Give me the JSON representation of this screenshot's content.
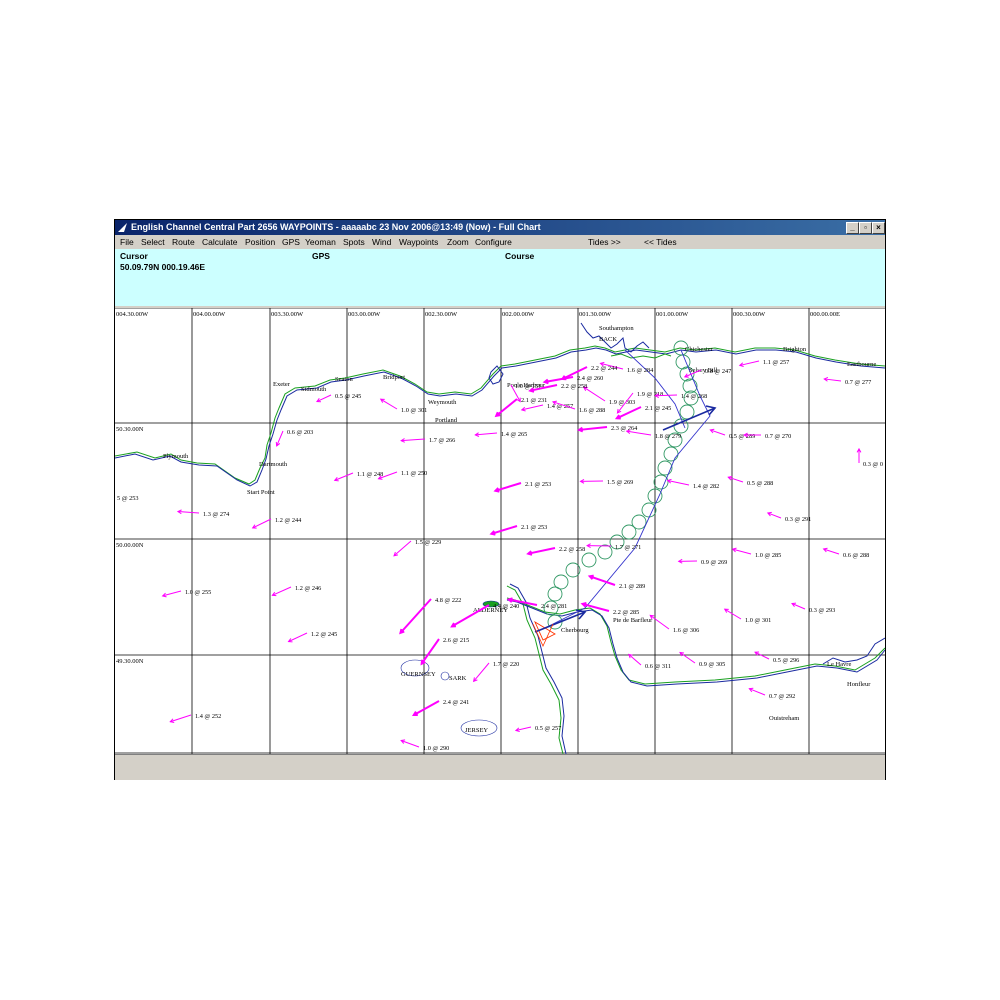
{
  "window": {
    "title": "English Channel Central Part 2656   WAYPOINTS - aaaaabc    23 Nov 2006@13:49 (Now) - Full Chart",
    "btn_min": "_",
    "btn_max": "▫",
    "btn_close": "×"
  },
  "menu": [
    "File",
    "Select",
    "Route",
    "Calculate",
    "Position",
    "GPS",
    "Yeoman",
    "Spots",
    "Wind",
    "Waypoints",
    "Zoom",
    "Configure",
    "Tides >>",
    "<< Tides"
  ],
  "info": {
    "cursor_label": "Cursor",
    "cursor_value": "50.09.79N   000.19.46E",
    "gps_label": "GPS",
    "course_label": "Course"
  },
  "colors": {
    "tide_arrow": "#ff00ff",
    "coast_blue": "#1a2aa0",
    "coast_green": "#1aa020",
    "route": "#3333cc",
    "circles": "#339966",
    "cherbourg_marker": "#ff3300"
  },
  "grid": {
    "lon_labels": [
      "004.30.00W",
      "004.00.00W",
      "003.30.00W",
      "003.00.00W",
      "002.30.00W",
      "002.00.00W",
      "001.30.00W",
      "001.00.00W",
      "000.30.00W",
      "000.00.00E"
    ],
    "lat_labels": [
      "50.30.00N",
      "50.00.00N",
      "49.30.00N"
    ]
  },
  "places": [
    "Southampton",
    "BACK",
    "Chichester",
    "Brighton",
    "Eastbourne",
    "Selsey Bill",
    "Poole Harbour",
    "Exeter",
    "Sidmouth",
    "Seaton",
    "Bridport",
    "Weymouth",
    "Portland",
    "Plymouth",
    "Dartmouth",
    "Start Point",
    "ALDERNEY",
    "Cherbourg",
    "Pte de Barfleur",
    "GUERNSEY",
    "SARK",
    "JERSEY",
    "Le Havre",
    "Honfleur",
    "Ouistreham"
  ],
  "tides": [
    "0.5 @ 245",
    "1.0 @ 301",
    "0.6 @ 203",
    "1.7 @ 266",
    "1.4 @ 265",
    "1.1 @ 248",
    "1.1 @ 250",
    "2.1 @ 253",
    "1.5 @ 269",
    "1.4 @ 282",
    "0.5 @ 288",
    "0.3 @ 291",
    "1.3 @ 274",
    "1.2 @ 244",
    "1.5 @ 229",
    "2.1 @ 253",
    "2.2 @ 258",
    "1.7 @ 271",
    "1.0 @ 285",
    "0.6 @ 288",
    "0.9 @ 269",
    "1.0 @ 255",
    "1.2 @ 246",
    "1.2 @ 245",
    "4.8 @ 222",
    "2.6 @ 215",
    "4.4 @ 240",
    "2.4 @ 281",
    "2.1 @ 289",
    "2.2 @ 285",
    "1.6 @ 306",
    "1.0 @ 301",
    "0.3 @ 293",
    "1.4 @ 252",
    "1.7 @ 220",
    "2.4 @ 241",
    "0.5 @ 257",
    "1.0 @ 290",
    "0.6 @ 311",
    "0.9 @ 305",
    "0.5 @ 296",
    "0.7 @ 292",
    "1.1 @ 257",
    "0.7 @ 277",
    "0.5 @ 289",
    "0.7 @ 270",
    "0.3 @ 0",
    "2.1 @ 231",
    "1.4 @ 257",
    "1.6 @ 288",
    "1.9 @ 303",
    "2.1 @ 245",
    "2.3 @ 264",
    "1.8 @ 279",
    "1.9 @ 218",
    "1.4 @ 268",
    "0.8 @ 247",
    "1.6 @ 284",
    "1.0 @ 151",
    "2.2 @ 258",
    "2.2 @ 244",
    "2.4 @ 260",
    "5 @ 253"
  ]
}
